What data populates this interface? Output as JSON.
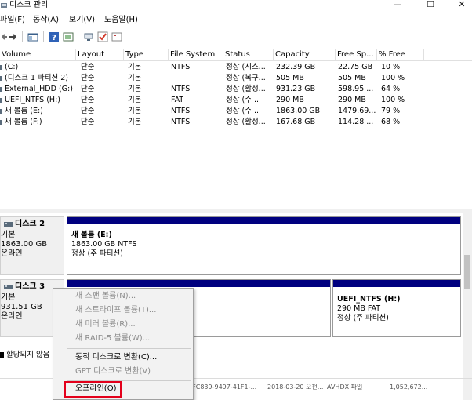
{
  "window": {
    "title": "디스크 관리",
    "buttons": {
      "minimize": "—",
      "maximize": "☐",
      "close": "✕"
    }
  },
  "menu": [
    "파일(F)",
    "동작(A)",
    "보기(V)",
    "도움말(H)"
  ],
  "toolbar": {
    "icons": [
      "back-arrow-icon",
      "forward-arrow-icon",
      "console-tree-icon",
      "help-icon",
      "properties-icon",
      "connect-icon",
      "check-icon",
      "settings-icon"
    ]
  },
  "volume_list": {
    "columns": [
      "Volume",
      "Layout",
      "Type",
      "File System",
      "Status",
      "Capacity",
      "Free Sp...",
      "% Free"
    ],
    "rows": [
      [
        "(C:)",
        "단순",
        "기본",
        "NTFS",
        "정상 (시스...",
        "232.39 GB",
        "22.75 GB",
        "10 %"
      ],
      [
        "(디스크 1 파티션 2)",
        "단순",
        "기본",
        "",
        "정상 (복구...",
        "505 MB",
        "505 MB",
        "100 %"
      ],
      [
        "External_HDD (G:)",
        "단순",
        "기본",
        "NTFS",
        "정상 (활성...",
        "931.23 GB",
        "598.95 ...",
        "64 %"
      ],
      [
        "UEFI_NTFS (H:)",
        "단순",
        "기본",
        "FAT",
        "정상 (주 ...",
        "290 MB",
        "290 MB",
        "100 %"
      ],
      [
        "새 볼륨 (E:)",
        "단순",
        "기본",
        "NTFS",
        "정상 (주 ...",
        "1863.00 GB",
        "1479.69...",
        "79 %"
      ],
      [
        "새 볼륨 (F:)",
        "단순",
        "기본",
        "NTFS",
        "정상 (활성...",
        "167.68 GB",
        "114.28 ...",
        "68 %"
      ]
    ]
  },
  "disks": {
    "disk2": {
      "name": "디스크 2",
      "type": "기본",
      "size": "1863.00 GB",
      "state": "온라인",
      "partition": {
        "name": "새 볼륨  (E:)",
        "size": "1863.00 GB NTFS",
        "status": "정상 (주 파티션)"
      }
    },
    "disk3": {
      "name": "디스크 3",
      "type": "기본",
      "size": "931.51 GB",
      "state": "온라인",
      "partition": {
        "name": "UEFI_NTFS  (H:)",
        "size": "290 MB FAT",
        "status": "정상 (주 파티션)"
      }
    }
  },
  "legend": {
    "unallocated": "할당되지 않음"
  },
  "bottom_row": {
    "id": "E3FC839-9497-41F1-...",
    "date": "2018-03-20 오전...",
    "type": "AVHDX 파일",
    "size": "1,052,672..."
  },
  "context_menu": {
    "items": [
      {
        "label": "새 스팬 볼륨(N)...",
        "disabled": true
      },
      {
        "label": "새 스트라이프 볼륨(T)...",
        "disabled": true
      },
      {
        "label": "새 미러 볼륨(R)...",
        "disabled": true
      },
      {
        "label": "새 RAID-5 볼륨(W)...",
        "disabled": true
      },
      {
        "label": "동적 디스크로 변환(C)...",
        "disabled": false
      },
      {
        "label": "GPT 디스크로 변환(V)",
        "disabled": true
      },
      {
        "label": "오프라인(O)",
        "disabled": false
      }
    ],
    "highlight_color": "#e3001b"
  },
  "colors": {
    "partition_bar": "#00007f"
  }
}
